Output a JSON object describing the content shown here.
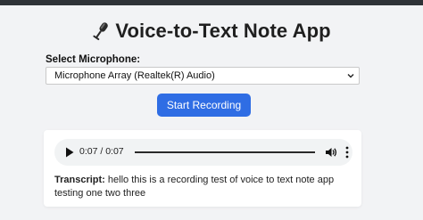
{
  "app": {
    "title": "Voice-to-Text Note App",
    "title_icon": "microphone-icon"
  },
  "microphone": {
    "label": "Select Microphone:",
    "selected": "Microphone Array (Realtek(R) Audio)"
  },
  "controls": {
    "start_label": "Start Recording",
    "accent_color": "#2f6de4"
  },
  "player": {
    "time": "0:07 / 0:07",
    "progress": 1.0
  },
  "transcript": {
    "label": "Transcript:",
    "text": "hello this is a recording test of voice to text note app testing one two three"
  }
}
